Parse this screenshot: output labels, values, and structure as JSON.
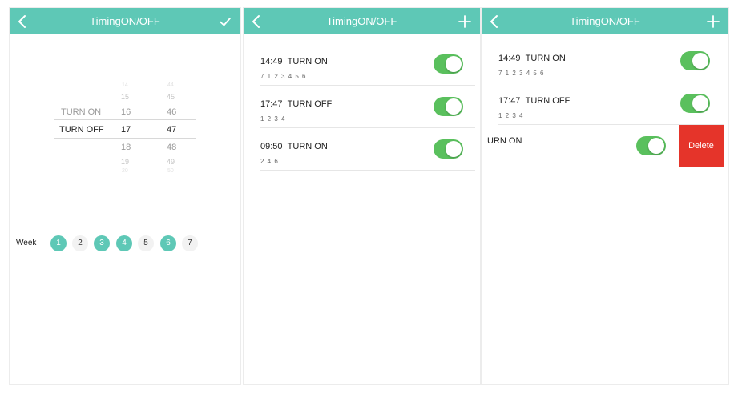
{
  "colors": {
    "header": "#5ec8b6",
    "toggle_on": "#5ac05d",
    "delete": "#e5342a",
    "day_selected": "#5ec8b6"
  },
  "screen1": {
    "title": "TimingON/OFF",
    "back_icon": "chevron-left-icon",
    "confirm_icon": "checkmark-icon",
    "picker": {
      "action": {
        "items": [
          "TURN ON",
          "TURN OFF"
        ],
        "selected": "TURN OFF"
      },
      "hour": {
        "items": [
          "14",
          "15",
          "16",
          "17",
          "18",
          "19",
          "20"
        ],
        "selected": "17"
      },
      "minute": {
        "items": [
          "44",
          "45",
          "46",
          "47",
          "48",
          "49",
          "50"
        ],
        "selected": "47"
      }
    },
    "week_label": "Week",
    "days": [
      {
        "label": "1",
        "selected": true
      },
      {
        "label": "2",
        "selected": false
      },
      {
        "label": "3",
        "selected": true
      },
      {
        "label": "4",
        "selected": true
      },
      {
        "label": "5",
        "selected": false
      },
      {
        "label": "6",
        "selected": true
      },
      {
        "label": "7",
        "selected": false
      }
    ]
  },
  "screen2": {
    "title": "TimingON/OFF",
    "back_icon": "chevron-left-icon",
    "add_icon": "plus-icon",
    "timers": [
      {
        "time": "14:49",
        "action": "TURN ON",
        "days": "7 1 2 3 4 5 6",
        "enabled": true
      },
      {
        "time": "17:47",
        "action": "TURN OFF",
        "days": "1 2 3 4",
        "enabled": true
      },
      {
        "time": "09:50",
        "action": "TURN ON",
        "days": "2 4 6",
        "enabled": true
      }
    ]
  },
  "screen3": {
    "title": "TimingON/OFF",
    "back_icon": "chevron-left-icon",
    "add_icon": "plus-icon",
    "timers": [
      {
        "time": "14:49",
        "action": "TURN ON",
        "days": "7 1 2 3 4 5 6",
        "enabled": true
      },
      {
        "time": "17:47",
        "action": "TURN OFF",
        "days": "1 2 3 4",
        "enabled": true
      }
    ],
    "swiped_row": {
      "text": "URN ON",
      "enabled": true
    },
    "delete_label": "Delete"
  }
}
